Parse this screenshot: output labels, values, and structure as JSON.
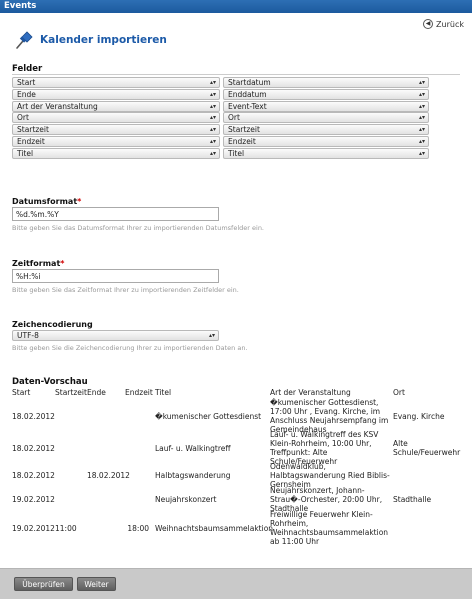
{
  "window": {
    "title": "Events"
  },
  "back_label": "Zurück",
  "heading": "Kalender importieren",
  "felder": {
    "title": "Felder",
    "rows": [
      {
        "left": "Start",
        "right": "Startdatum"
      },
      {
        "left": "Ende",
        "right": "Enddatum"
      },
      {
        "left": "Art der Veranstaltung",
        "right": "Event-Text"
      },
      {
        "left": "Ort",
        "right": "Ort"
      },
      {
        "left": "Startzeit",
        "right": "Startzeit"
      },
      {
        "left": "Endzeit",
        "right": "Endzeit"
      },
      {
        "left": "Titel",
        "right": "Titel"
      }
    ]
  },
  "datumsformat": {
    "label": "Datumsformat",
    "required_mark": "*",
    "value": "%d.%m.%Y",
    "help": "Bitte geben Sie das Datumsformat Ihrer zu importierenden Datumsfelder ein."
  },
  "zeitformat": {
    "label": "Zeitformat",
    "required_mark": "*",
    "value": "%H:%i",
    "help": "Bitte geben Sie das Zeitformat Ihrer zu importierenden Zeitfelder ein."
  },
  "encoding": {
    "label": "Zeichencodierung",
    "value": "UTF-8",
    "help": "Bitte geben Sie die Zeichencodierung Ihrer zu importierenden Daten an."
  },
  "preview": {
    "title": "Daten-Vorschau",
    "headers": {
      "start": "Start",
      "startzeit": "Startzeit",
      "ende": "Ende",
      "endzeit": "Endzeit",
      "titel": "Titel",
      "art": "Art der Veranstaltung",
      "ort": "Ort"
    },
    "rows": [
      {
        "start": "18.02.2012",
        "startzeit": "",
        "ende": "",
        "endzeit": "",
        "titel": "�kumenischer Gottesdienst",
        "art": [
          "�kumenischer Gottesdienst,",
          "17:00 Uhr , Evang. Kirche, im",
          "Anschluss Neujahrsempfang im",
          "Gemeindehaus"
        ],
        "ort": [
          "Evang. Kirche"
        ]
      },
      {
        "start": "18.02.2012",
        "startzeit": "",
        "ende": "",
        "endzeit": "",
        "titel": "Lauf- u. Walkingtreff",
        "art": [
          "Lauf- u. Walkingtreff des KSV",
          "Klein-Rohrheim, 10:00 Uhr,",
          "Treffpunkt: Alte",
          "Schule/Feuerwehr"
        ],
        "ort": [
          "Alte",
          "Schule/Feuerwehr"
        ]
      },
      {
        "start": "18.02.2012",
        "startzeit": "",
        "ende": "18.02.2012",
        "endzeit": "",
        "titel": "Halbtagswanderung",
        "art": [
          "Odenwaldklub,",
          "Halbtagswanderung Ried Biblis-",
          "Gernsheim"
        ],
        "ort": []
      },
      {
        "start": "19.02.2012",
        "startzeit": "",
        "ende": "",
        "endzeit": "",
        "titel": "Neujahrskonzert",
        "art": [
          "Neujahrskonzert, Johann-",
          "Strau�-Orchester, 20:00 Uhr,",
          "Stadthalle"
        ],
        "ort": [
          "Stadthalle"
        ]
      },
      {
        "start": "19.02.2012",
        "startzeit": "11:00",
        "ende": "",
        "endzeit": "18:00",
        "titel": "Weihnachtsbaumsammelaktion",
        "art": [
          "Freiwillige Feuerwehr Klein-",
          "Rohrheim,",
          "Weihnachtsbaumsammelaktion",
          "ab 11:00 Uhr"
        ],
        "ort": []
      }
    ]
  },
  "footer": {
    "check_label": "Überprüfen",
    "next_label": "Weiter"
  }
}
